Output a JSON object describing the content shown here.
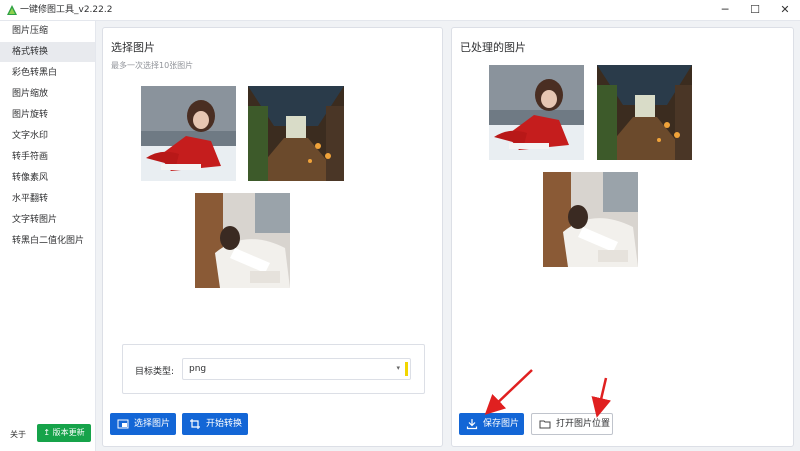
{
  "app": {
    "title": "一键修图工具_v2.22.2"
  },
  "window_controls": {
    "minimize": "─",
    "maximize": "☐",
    "close": "✕"
  },
  "sidebar": {
    "items": [
      {
        "label": "图片压缩",
        "active": false
      },
      {
        "label": "格式转换",
        "active": true
      },
      {
        "label": "彩色转黑白",
        "active": false
      },
      {
        "label": "图片缩放",
        "active": false
      },
      {
        "label": "图片旋转",
        "active": false
      },
      {
        "label": "文字水印",
        "active": false
      },
      {
        "label": "转手符画",
        "active": false
      },
      {
        "label": "转像素风",
        "active": false
      },
      {
        "label": "水平翻转",
        "active": false
      },
      {
        "label": "文字转图片",
        "active": false
      },
      {
        "label": "转黑白二值化图片",
        "active": false
      }
    ],
    "about": "关于",
    "update_button": "版本更新"
  },
  "left_panel": {
    "title": "选择图片",
    "subtitle": "最多一次选择10张图片",
    "target": {
      "label": "目标类型:",
      "value": "png",
      "caret": "▾"
    },
    "buttons": {
      "select": "选择图片",
      "convert": "开始转换"
    }
  },
  "right_panel": {
    "title": "已处理的图片",
    "buttons": {
      "save": "保存图片",
      "open_location": "打开图片位置"
    }
  },
  "colors": {
    "primary": "#1366d6",
    "update_green": "#16a34a",
    "annotation_red": "#e02020",
    "sidebar_active": "#e8eaee"
  }
}
